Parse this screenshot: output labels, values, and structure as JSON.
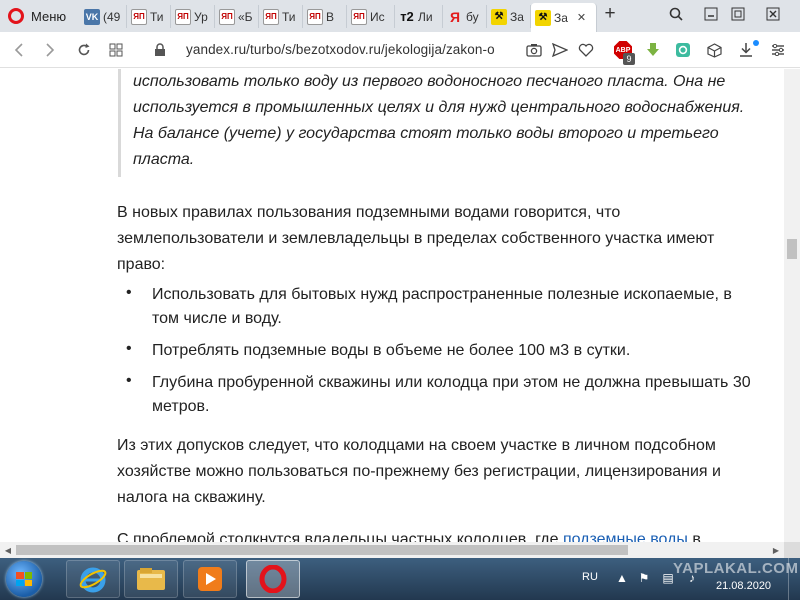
{
  "browser": {
    "menu_label": "Меню",
    "tabs": [
      {
        "title": "(49",
        "favicon": "vk"
      },
      {
        "title": "Ти",
        "favicon": "yap"
      },
      {
        "title": "Ур",
        "favicon": "yap"
      },
      {
        "title": "«Б",
        "favicon": "yap"
      },
      {
        "title": "Ти",
        "favicon": "yap"
      },
      {
        "title": "В",
        "favicon": "yap"
      },
      {
        "title": "Ис",
        "favicon": "yap"
      },
      {
        "title": "Ли",
        "favicon": "t2",
        "favicon_text": "т2"
      },
      {
        "title": "бу",
        "favicon": "yandex",
        "favicon_text": "Я"
      },
      {
        "title": "За",
        "favicon": "sign"
      },
      {
        "title": "За",
        "favicon": "sign",
        "active": true
      }
    ],
    "url": "yandex.ru/turbo/s/bezotxodov.ru/jekologija/zakon-o",
    "abp_badge": "ABP",
    "abp_count": "9"
  },
  "article": {
    "quote": "использовать только воду из первого водоносного песчаного пласта. Она не используется в промышленных целях и для нужд центрального водоснабжения. На балансе (учете) у государства стоят только воды второго и третьего пласта.",
    "intro": "В новых правилах пользования подземными водами говорится, что землепользователи и землевладельцы в пределах собственного участка имеют право:",
    "bullet_symbol": "•",
    "bullets": [
      "Использовать для бытовых нужд распространенные полезные ископаемые, в том числе и воду.",
      "Потреблять подземные воды в объеме не более 100 м3 в сутки.",
      "Глубина пробуренной скважины или колодца при этом не должна превышать 30 метров."
    ],
    "conclusion": "Из этих допусков следует, что колодцами на своем участке в личном подсобном хозяйстве можно пользоваться по-прежнему без регистрации, лицензирования и налога на скважину.",
    "last_text": "С проблемой столкнутся владельцы частных колодцев, где ",
    "last_link": "подземные воды",
    "last_text_end": " в"
  },
  "taskbar": {
    "language": "RU",
    "date": "21.08.2020",
    "watermark": "YAPLAKAL.COM"
  },
  "colors": {
    "opera_red": "#e3131b",
    "link": "#1a5fb4",
    "tab_strip": "#dfe3e8"
  }
}
